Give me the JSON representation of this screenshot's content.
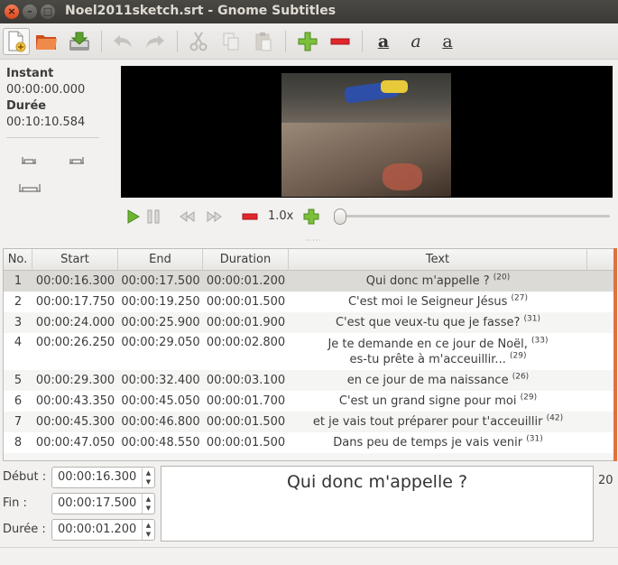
{
  "window": {
    "title": "Noel2011sketch.srt - Gnome Subtitles"
  },
  "toolbar": {
    "new": "new-file-icon",
    "open": "open-folder-icon",
    "save": "save-icon",
    "undo": "undo-icon",
    "redo": "redo-icon",
    "cut": "cut-icon",
    "copy": "copy-icon",
    "paste": "paste-icon",
    "insert": "add-icon",
    "delete": "remove-icon",
    "bold": "a",
    "italic": "a",
    "underline": "a"
  },
  "info": {
    "instant_label": "Instant",
    "instant_value": "00:00:00.000",
    "duration_label": "Durée",
    "duration_value": "00:10:10.584"
  },
  "player": {
    "speed": "1.0x",
    "position_fraction": 0.0
  },
  "table": {
    "headers": {
      "no": "No.",
      "start": "Start",
      "end": "End",
      "duration": "Duration",
      "text": "Text"
    },
    "rows": [
      {
        "no": "1",
        "start": "00:00:16.300",
        "end": "00:00:17.500",
        "duration": "00:00:01.200",
        "text": "Qui donc m'appelle ?",
        "count": "(20)"
      },
      {
        "no": "2",
        "start": "00:00:17.750",
        "end": "00:00:19.250",
        "duration": "00:00:01.500",
        "text": "C'est moi le Seigneur Jésus",
        "count": "(27)"
      },
      {
        "no": "3",
        "start": "00:00:24.000",
        "end": "00:00:25.900",
        "duration": "00:00:01.900",
        "text": "C'est que veux-tu que je fasse?",
        "count": "(31)"
      },
      {
        "no": "4",
        "start": "00:00:26.250",
        "end": "00:00:29.050",
        "duration": "00:00:02.800",
        "text": "Je te demande en ce jour de Noël,",
        "count": "(33)",
        "text2": "es-tu prête à m'acceuillir...",
        "count2": "(29)"
      },
      {
        "no": "5",
        "start": "00:00:29.300",
        "end": "00:00:32.400",
        "duration": "00:00:03.100",
        "text": "en ce jour de ma naissance",
        "count": "(26)"
      },
      {
        "no": "6",
        "start": "00:00:43.350",
        "end": "00:00:45.050",
        "duration": "00:00:01.700",
        "text": "C'est un grand signe pour moi",
        "count": "(29)"
      },
      {
        "no": "7",
        "start": "00:00:45.300",
        "end": "00:00:46.800",
        "duration": "00:00:01.500",
        "text": "et je vais tout préparer pour t'acceuillir",
        "count": "(42)"
      },
      {
        "no": "8",
        "start": "00:00:47.050",
        "end": "00:00:48.550",
        "duration": "00:00:01.500",
        "text": "Dans peu de temps je vais venir",
        "count": "(31)"
      }
    ]
  },
  "edit": {
    "start_label": "Début :",
    "start_value": "00:00:16.300",
    "end_label": "Fin :",
    "end_value": "00:00:17.500",
    "duration_label": "Durée :",
    "duration_value": "00:00:01.200",
    "text": "Qui donc m'appelle ?",
    "char_count": "20"
  }
}
